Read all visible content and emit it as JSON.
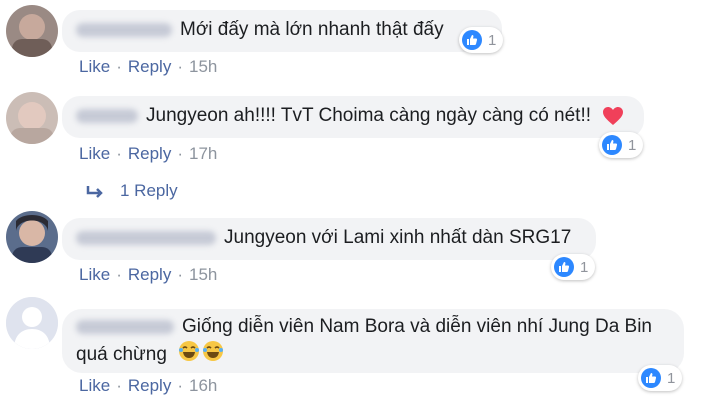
{
  "colors": {
    "bubble_bg": "#f2f3f5",
    "link": "#4b67a1",
    "meta": "#8d949e",
    "like_blue": "#2d88ff",
    "heart": "#f0405a"
  },
  "comments": [
    {
      "text": "Mới đấy mà lớn nhanh thật đấy",
      "like_label": "Like",
      "reply_label": "Reply",
      "time": "15h",
      "reaction_count": "1",
      "reaction_icon": "like-icon"
    },
    {
      "text": "Jungyeon ah!!!! TvT Choima càng ngày càng có nét!!",
      "emoji_icon": "heart-icon",
      "like_label": "Like",
      "reply_label": "Reply",
      "time": "17h",
      "reaction_count": "1",
      "reaction_icon": "like-icon",
      "replies_label": "1 Reply"
    },
    {
      "text": "Jungyeon với Lami xinh nhất dàn SRG17",
      "like_label": "Like",
      "reply_label": "Reply",
      "time": "15h",
      "reaction_count": "1",
      "reaction_icon": "like-icon"
    },
    {
      "text_line1": "Giống diễn viên Nam Bora và diễn viên nhí Jung Da Bin",
      "text_line2": "quá chừng",
      "emoji_icon": "laughing-tears-emoji",
      "like_label": "Like",
      "reply_label": "Reply",
      "time": "16h",
      "reaction_count": "1",
      "reaction_icon": "like-icon"
    }
  ]
}
